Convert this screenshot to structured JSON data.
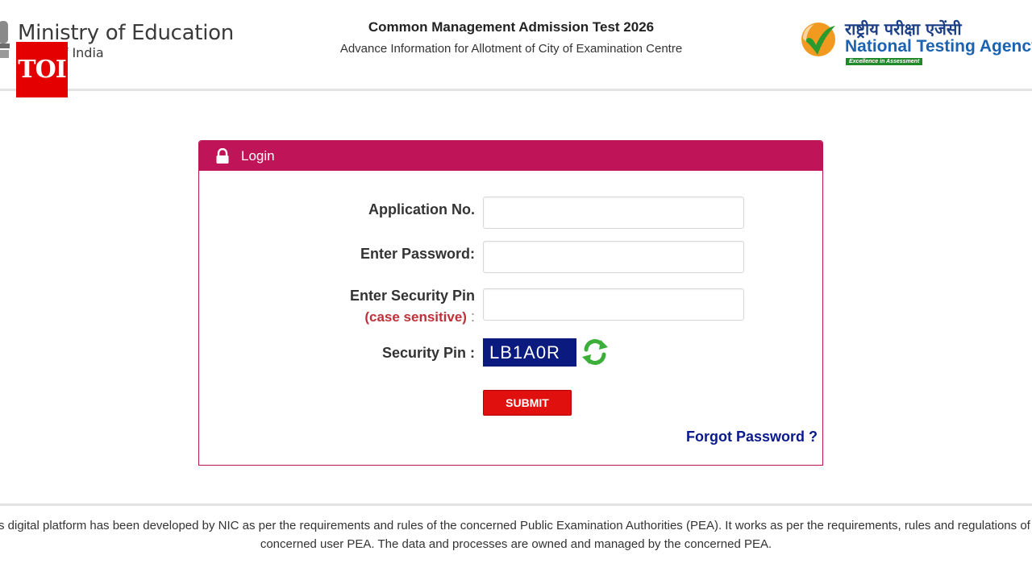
{
  "header": {
    "ministry_title": "Ministry of Education",
    "ministry_subtitle": "ment of India",
    "toi_badge": "TOI",
    "exam_title": "Common Management Admission Test 2026",
    "exam_subtitle": "Advance Information for Allotment of City of Examination Centre",
    "nta_hindi": "राष्ट्रीय परीक्षा एजेंसी",
    "nta_name": "National Testing Agency",
    "nta_tagline": "Excellence in Assessment"
  },
  "login": {
    "title": "Login",
    "application_label": "Application No.",
    "application_value": "",
    "password_label": "Enter Password:",
    "password_value": "",
    "pin_label": "Enter Security Pin",
    "pin_case_note": "(case sensitive)",
    "pin_colon": ":",
    "pin_value": "",
    "captcha_label": "Security Pin :",
    "captcha_code": "LB1A0R",
    "submit_label": "SUBMIT",
    "forgot_label": "Forgot Password ?"
  },
  "footer": {
    "text": "This digital platform has been developed by NIC as per the requirements and rules of the concerned Public Examination Authorities (PEA). It works as per the requirements, rules and regulations of the concerned user PEA. The data and processes are owned and managed by the concerned PEA."
  },
  "colors": {
    "panel_header": "#bf1558",
    "submit": "#e0100f",
    "captcha_bg": "#0a1a7e",
    "link": "#0a1a8c",
    "case_note": "#c0303a",
    "toi": "#e50000"
  },
  "icons": {
    "lock": "lock-icon",
    "refresh": "refresh-icon",
    "emblem": "emblem-icon",
    "nta_logo": "nta-check-logo"
  }
}
